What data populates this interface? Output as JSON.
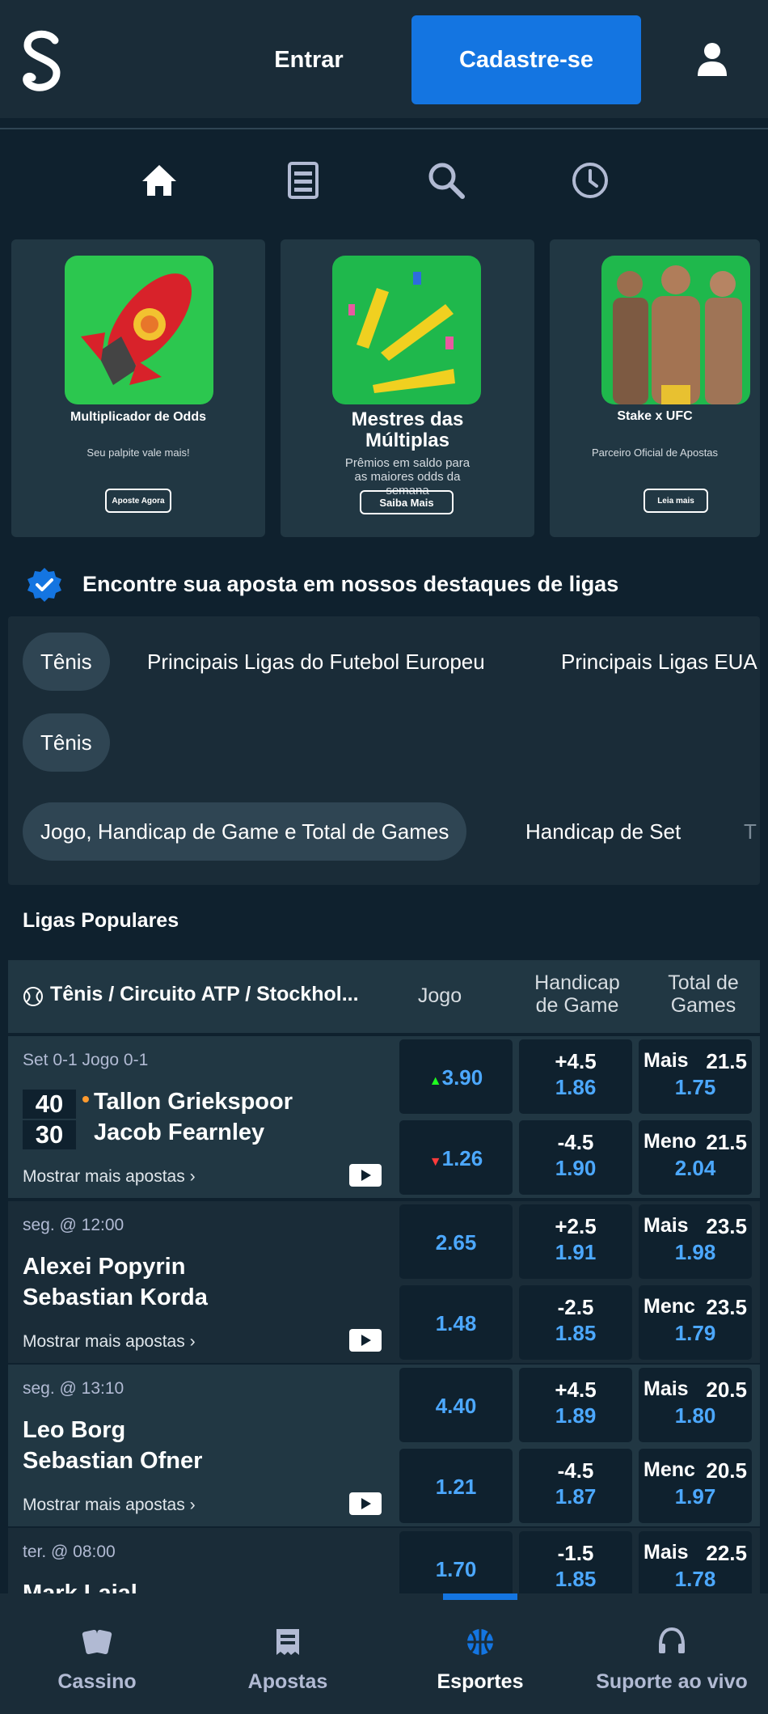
{
  "header": {
    "login_label": "Entrar",
    "register_label": "Cadastre-se"
  },
  "nav_icons": [
    "home-icon",
    "betslip-icon",
    "search-icon",
    "clock-icon"
  ],
  "promos": [
    {
      "title": "Multiplicador de Odds",
      "subtitle": "Seu palpite vale mais!",
      "button": "Aposte Agora"
    },
    {
      "title": "Mestres das Múltiplas",
      "subtitle": "Prêmios em saldo para as maiores odds da semana",
      "button": "Saiba Mais"
    },
    {
      "title": "Stake x UFC",
      "subtitle": "Parceiro Oficial de Apostas",
      "button": "Leia mais"
    }
  ],
  "highlights_title": "Encontre sua aposta em nossos destaques de ligas",
  "league_chips_row1": [
    "Tênis",
    "Principais Ligas do Futebol Europeu",
    "Principais Ligas EUA"
  ],
  "league_chips_row2": [
    "Tênis"
  ],
  "market_chips": [
    "Jogo, Handicap de Game e Total de Games",
    "Handicap de Set",
    "T"
  ],
  "popular_title": "Ligas Populares",
  "table": {
    "league": "Tênis / Circuito ATP / Stockhol...",
    "col_jogo": "Jogo",
    "col_handicap_line1": "Handicap",
    "col_handicap_line2": "de Game",
    "col_total_line1": "Total de",
    "col_total_line2": "Games"
  },
  "matches": [
    {
      "time": "Set 0-1 Jogo 0-1",
      "team1": "Tallon Griekspoor",
      "team2": "Jacob Fearnley",
      "score1": "40",
      "score2": "30",
      "more": "Mostrar mais apostas ›",
      "jogo1": "3.90",
      "jogo2": "1.26",
      "hcap1_line": "+4.5",
      "hcap1_odd": "1.86",
      "hcap2_line": "-4.5",
      "hcap2_odd": "1.90",
      "tot1_label": "Mais",
      "tot1_line": "21.5",
      "tot1_odd": "1.75",
      "tot2_label": "Meno",
      "tot2_line": "21.5",
      "tot2_odd": "2.04"
    },
    {
      "time": "seg. @ 12:00",
      "team1": "Alexei Popyrin",
      "team2": "Sebastian Korda",
      "more": "Mostrar mais apostas ›",
      "jogo1": "2.65",
      "jogo2": "1.48",
      "hcap1_line": "+2.5",
      "hcap1_odd": "1.91",
      "hcap2_line": "-2.5",
      "hcap2_odd": "1.85",
      "tot1_label": "Mais",
      "tot1_line": "23.5",
      "tot1_odd": "1.98",
      "tot2_label": "Menc",
      "tot2_line": "23.5",
      "tot2_odd": "1.79"
    },
    {
      "time": "seg. @ 13:10",
      "team1": "Leo Borg",
      "team2": "Sebastian Ofner",
      "more": "Mostrar mais apostas ›",
      "jogo1": "4.40",
      "jogo2": "1.21",
      "hcap1_line": "+4.5",
      "hcap1_odd": "1.89",
      "hcap2_line": "-4.5",
      "hcap2_odd": "1.87",
      "tot1_label": "Mais",
      "tot1_line": "20.5",
      "tot1_odd": "1.80",
      "tot2_label": "Menc",
      "tot2_line": "20.5",
      "tot2_odd": "1.97"
    },
    {
      "time": "ter. @ 08:00",
      "team1": "Mark Lajal",
      "jogo1": "1.70",
      "hcap1_line": "-1.5",
      "hcap1_odd": "1.85",
      "tot1_label": "Mais",
      "tot1_line": "22.5",
      "tot1_odd": "1.78"
    }
  ],
  "bottom_nav": [
    "Cassino",
    "Apostas",
    "Esportes",
    "Suporte ao vivo"
  ],
  "colors": {
    "bg": "#0f212e",
    "panel": "#1a2c38",
    "card": "#213743",
    "accent": "#1475e1",
    "odd_blue": "#4ca8ff"
  }
}
